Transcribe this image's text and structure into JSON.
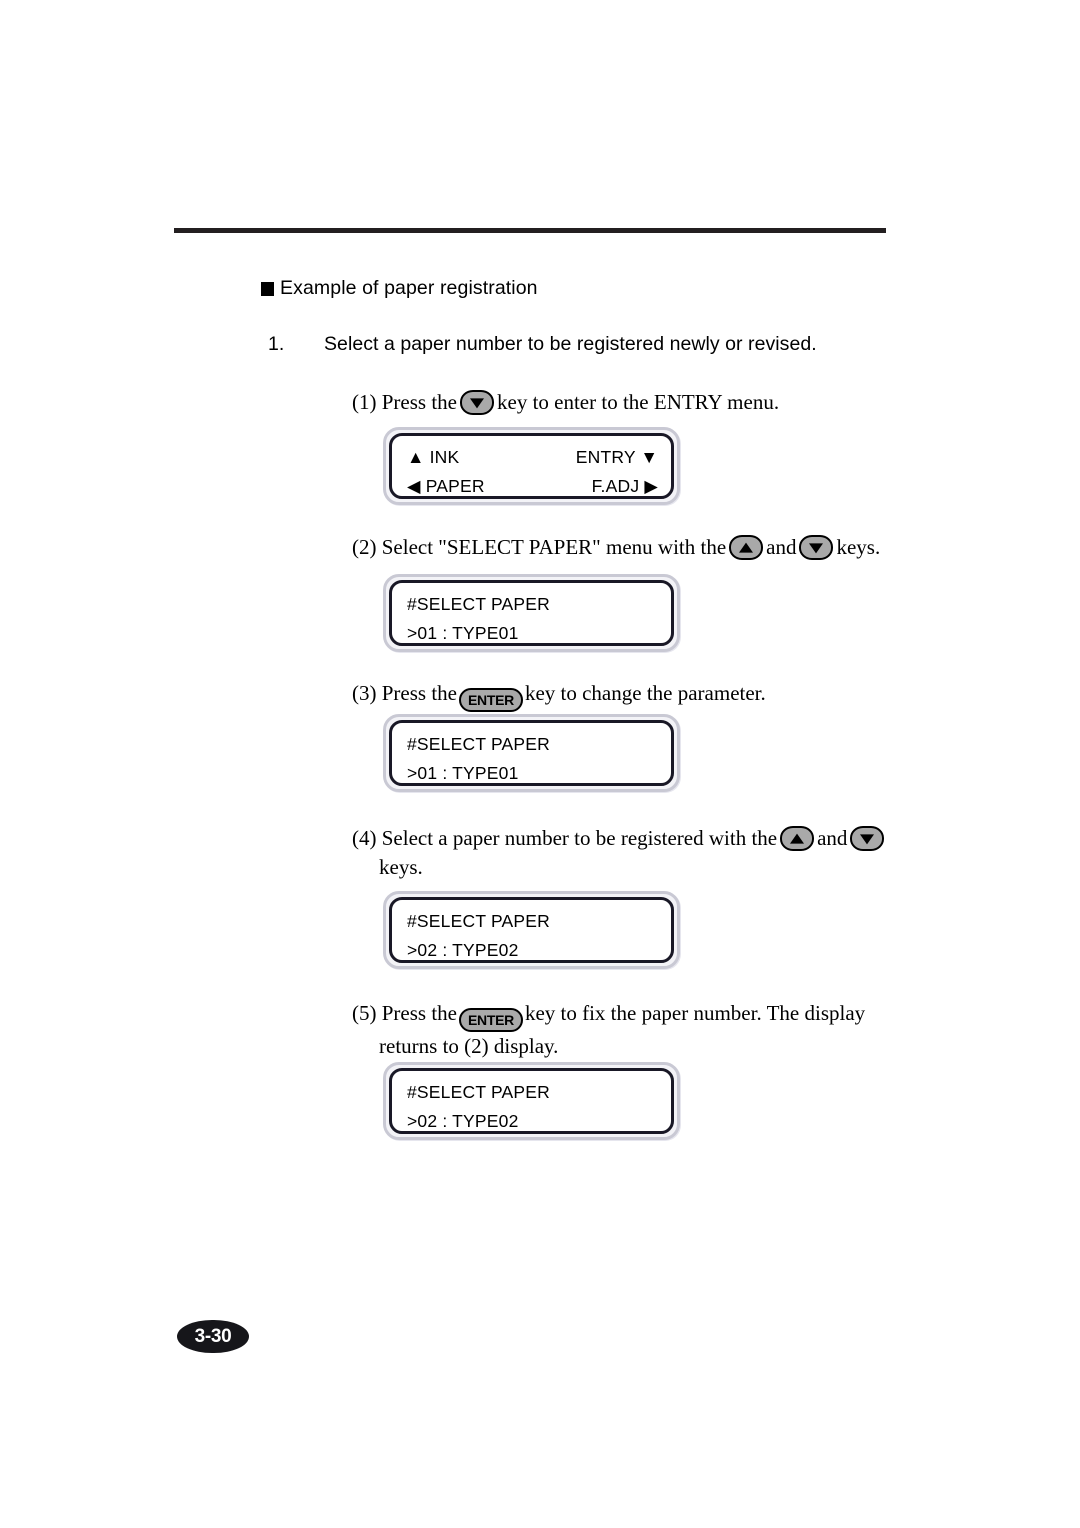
{
  "document": {
    "page_number": "3-30"
  },
  "section": {
    "heading": "Example of paper registration"
  },
  "steps": [
    {
      "number": "1.",
      "text": "Select a paper number to be registered newly or revised."
    }
  ],
  "substeps": [
    {
      "marker": "(1)",
      "text_before": "Press the",
      "key": "down-arrow",
      "text_after": "key to enter to the ENTRY menu.",
      "second_line": ""
    },
    {
      "marker": "(2)",
      "text_before": "Select \"SELECT PAPER\" menu with the",
      "key": "up-arrow",
      "text_middle": "and",
      "key2": "down-arrow",
      "text_after": "keys.",
      "second_line": ""
    },
    {
      "marker": "(3)",
      "text_before": "Press the",
      "key": "ENTER",
      "text_after": "key to change the parameter.",
      "second_line": ""
    },
    {
      "marker": "(4)",
      "text_before": "Select a paper number to be registered with the",
      "key": "up-arrow",
      "text_middle": "and",
      "key2": "down-arrow",
      "text_after": "",
      "second_line": "keys."
    },
    {
      "marker": "(5)",
      "text_before": "Press the",
      "key": "ENTER",
      "text_after": "key to fix the paper number.  The display",
      "second_line": "returns to (2) display."
    }
  ],
  "lcd_screens": [
    {
      "id": "entry-menu",
      "line1_left": "▲ INK",
      "line1_right": "ENTRY ▼",
      "line2_left": "◀ PAPER",
      "line2_right": "F.ADJ ▶"
    },
    {
      "id": "select-paper-01-a",
      "line1_left": "#SELECT PAPER",
      "line1_right": "",
      "line2_left": ">01 : TYPE01",
      "line2_right": ""
    },
    {
      "id": "select-paper-01-b",
      "line1_left": "#SELECT PAPER",
      "line1_right": "",
      "line2_left": ">01 : TYPE01",
      "line2_right": ""
    },
    {
      "id": "select-paper-02-a",
      "line1_left": "#SELECT PAPER",
      "line1_right": "",
      "line2_left": ">02 : TYPE02",
      "line2_right": ""
    },
    {
      "id": "select-paper-02-b",
      "line1_left": "#SELECT PAPER",
      "line1_right": "",
      "line2_left": ">02 : TYPE02",
      "line2_right": ""
    }
  ],
  "key_labels": {
    "enter": "ENTER"
  },
  "colors": {
    "rule": "#231f20",
    "key_face": "#a9a9a9",
    "lcd_frame": "#c9c9d4",
    "lcd_border": "#191826",
    "badge": "#16161a"
  }
}
